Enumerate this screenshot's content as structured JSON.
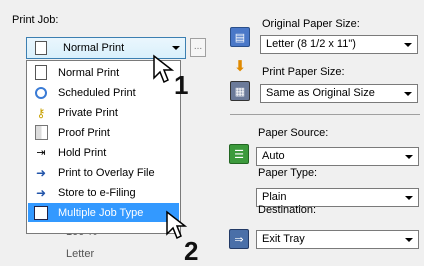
{
  "left": {
    "print_job_label": "Print Job:",
    "combo_value": "Normal Print",
    "menu_items": [
      {
        "label": "Normal Print",
        "icon": "document-icon"
      },
      {
        "label": "Scheduled Print",
        "icon": "clock-icon"
      },
      {
        "label": "Private Print",
        "icon": "key-icon"
      },
      {
        "label": "Proof Print",
        "icon": "proof-icon"
      },
      {
        "label": "Hold Print",
        "icon": "hold-icon"
      },
      {
        "label": "Print to Overlay File",
        "icon": "overlay-icon"
      },
      {
        "label": "Store to e-Filing",
        "icon": "efiling-icon"
      },
      {
        "label": "Multiple Job Type",
        "icon": "multiple-job-icon",
        "selected": true
      }
    ],
    "ellipsis_label": "...",
    "below_text_1": "100 %",
    "below_text_2": "Letter"
  },
  "right": {
    "original_paper_size_label": "Original Paper Size:",
    "original_paper_size_value": "Letter (8 1/2 x 11\")",
    "print_paper_size_label": "Print Paper Size:",
    "print_paper_size_value": "Same as Original Size",
    "paper_source_label": "Paper Source:",
    "paper_source_value": "Auto",
    "paper_type_label": "Paper Type:",
    "paper_type_value": "Plain",
    "destination_label": "Destination:",
    "destination_value": "Exit Tray"
  },
  "callouts": [
    "1",
    "2"
  ],
  "colors": {
    "selection": "#3399ff",
    "combo_highlight_border": "#3c7fb1"
  }
}
